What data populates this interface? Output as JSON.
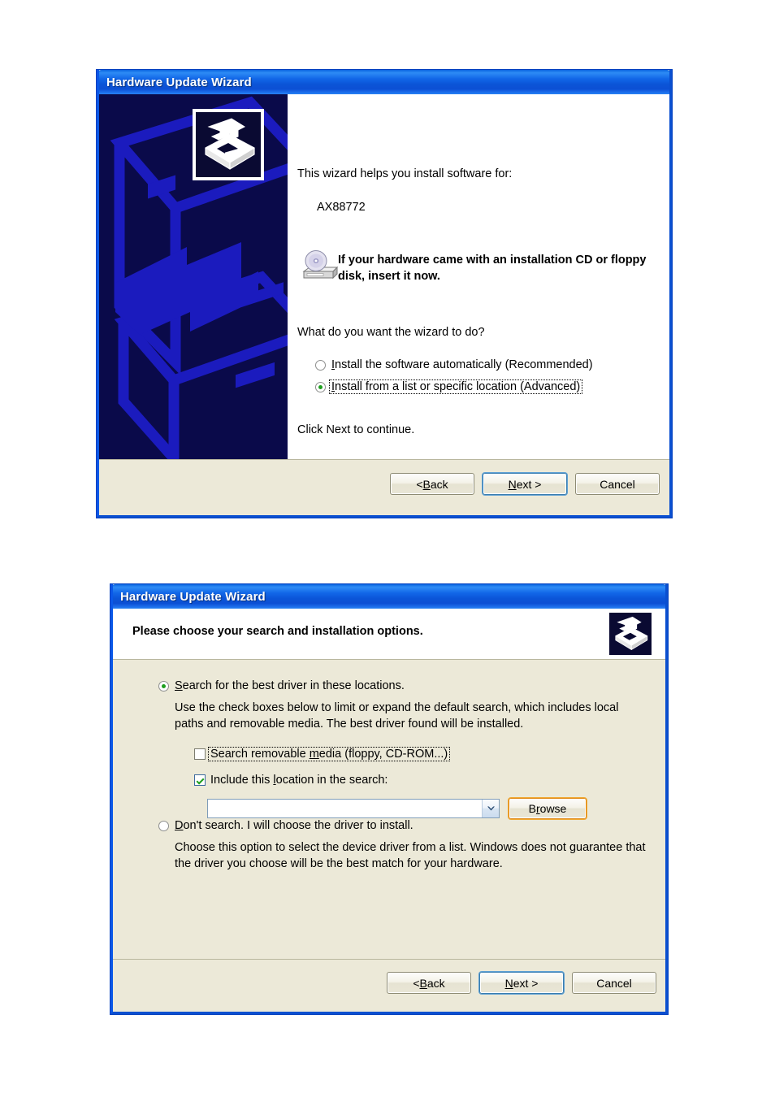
{
  "page": {
    "background": "#ffffff"
  },
  "colors": {
    "titlebar_blue": "#0A58E8",
    "dialog_face": "#ECE9D8",
    "watermark_navy": "#0A0A4A",
    "watermark_accent": "#1616AF",
    "radio_green": "#1E9F1E",
    "focus_orange": "#E08A1A",
    "default_button_blue": "#3C7FB1"
  },
  "dialog_welcome": {
    "title": "Hardware Update Wizard",
    "wizard_icon": "hardware-wizard-icon",
    "intro_line": "This wizard helps you install software for:",
    "device_name": "AX88772",
    "cd_icon": "cdrom-drive-icon",
    "cd_notice": "If your hardware came with an installation CD or floppy disk, insert it now.",
    "question": "What do you want the wizard to do?",
    "options": [
      {
        "label": "Install the software automatically (Recommended)",
        "accel": "I",
        "selected": false,
        "focused": false
      },
      {
        "label": "Install from a list or specific location (Advanced)",
        "accel": "I",
        "selected": true,
        "focused": true
      }
    ],
    "footer_note": "Click Next to continue.",
    "buttons": [
      {
        "label": "< Back",
        "accel": "B",
        "default": false,
        "focus": "none"
      },
      {
        "label": "Next >",
        "accel": "N",
        "default": true,
        "focus": "default"
      },
      {
        "label": "Cancel",
        "accel": "",
        "default": false,
        "focus": "none"
      }
    ]
  },
  "dialog_options": {
    "title": "Hardware Update Wizard",
    "header_title": "Please choose your search and installation options.",
    "header_icon": "hardware-wizard-icon",
    "radio_search": {
      "label": "Search for the best driver in these locations.",
      "accel": "S",
      "selected": true
    },
    "search_description": "Use the check boxes below to limit or expand the default search, which includes local paths and removable media. The best driver found will be installed.",
    "checkboxes": [
      {
        "label": "Search removable media (floppy, CD-ROM...)",
        "accel": "m",
        "checked": false,
        "focused": true
      },
      {
        "label": "Include this location in the search:",
        "accel": "l",
        "checked": true,
        "focused": false
      }
    ],
    "location_combo": {
      "value": "",
      "placeholder": "",
      "arrow_icon": "chevron-down-icon"
    },
    "browse_button": {
      "label": "Browse",
      "accel": "r",
      "focus": "orange"
    },
    "radio_nosearch": {
      "label": "Don't search. I will choose the driver to install.",
      "accel": "D",
      "selected": false
    },
    "nosearch_description": "Choose this option to select the device driver from a list.  Windows does not guarantee that the driver you choose will be the best match for your hardware.",
    "buttons": [
      {
        "label": "< Back",
        "accel": "B",
        "default": false,
        "focus": "none"
      },
      {
        "label": "Next >",
        "accel": "N",
        "default": true,
        "focus": "default"
      },
      {
        "label": "Cancel",
        "accel": "",
        "default": false,
        "focus": "none"
      }
    ]
  }
}
